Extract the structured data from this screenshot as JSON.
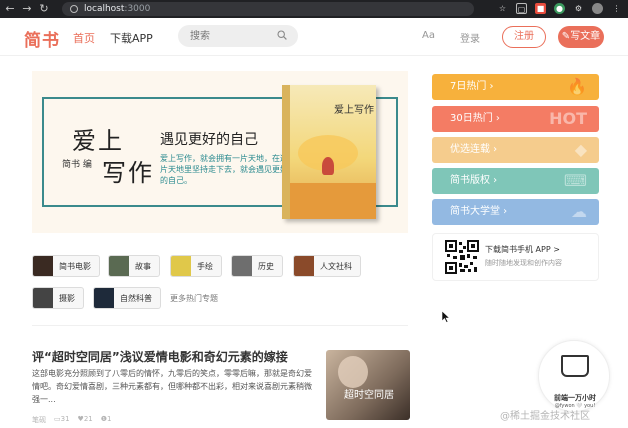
{
  "browser": {
    "url_host": "localhost",
    "url_port": ":3000"
  },
  "header": {
    "logo": "简书",
    "nav_home": "首页",
    "nav_app": "下载APP",
    "search_placeholder": "搜索",
    "font_toggle": "Aa",
    "login": "登录",
    "register": "注册",
    "write": "写文章"
  },
  "banner": {
    "title_line1": "爱上",
    "title_line2": "写作",
    "editor": "简书 编",
    "slogan": "遇见更好的自己",
    "description": "爱上写作，就会拥有一片天地，在这片天地里坚持走下去，就会遇见更好的自己。",
    "book_title": "爱上写作"
  },
  "topics": [
    {
      "label": "简书电影",
      "color": "#3a2a22"
    },
    {
      "label": "故事",
      "color": "#5a6a52"
    },
    {
      "label": "手绘",
      "color": "#e0c84a"
    },
    {
      "label": "历史",
      "color": "#6e6e6e"
    },
    {
      "label": "人文社科",
      "color": "#8a4a2a"
    },
    {
      "label": "摄影",
      "color": "#444444"
    },
    {
      "label": "自然科普",
      "color": "#1e2a3a"
    }
  ],
  "more_topics": "更多热门专题",
  "article": {
    "title": "评“超时空同居”浅议爱情电影和奇幻元素的嫁接",
    "abstract": "这部电影充分照顾到了八零后的情怀，九零后的笑点，零零后嘛，那就是奇幻爱情吧。奇幻爱情喜剧，三种元素都有，但哪种都不出彩，相对来说喜剧元素稍微强一...",
    "author": "笔砚",
    "comments": "31",
    "likes": "21",
    "rewards": "1",
    "thumb_text": "超时空同居"
  },
  "boards": [
    {
      "label": "7日热门",
      "deco": "🔥",
      "color": "#f7b13c"
    },
    {
      "label": "30日热门",
      "deco": "HOT",
      "color": "#f47c64"
    },
    {
      "label": "优选连载",
      "deco": "◆",
      "color": "#f5cc8d"
    },
    {
      "label": "简书版权",
      "deco": "⌨",
      "color": "#7fc6b8"
    },
    {
      "label": "简书大学堂",
      "deco": "☁",
      "color": "#93b9e2"
    }
  ],
  "app_download": {
    "title": "下载简书手机 APP >",
    "subtitle": "随时随地发现和创作内容"
  },
  "badge": {
    "text": "前端一万小时",
    "sub": "@fywon 🤍 you!"
  },
  "watermark": "@稀土掘金技术社区"
}
